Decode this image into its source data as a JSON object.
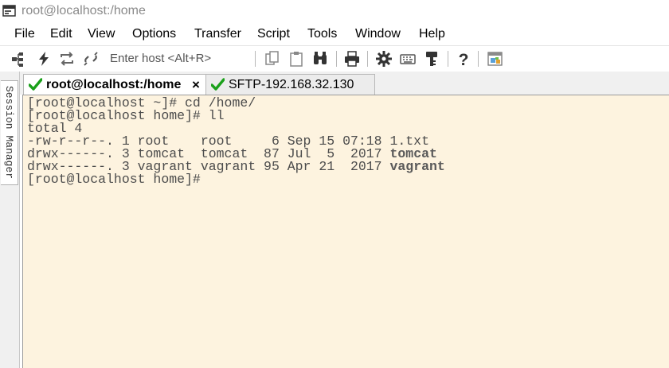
{
  "window": {
    "title": "root@localhost:/home"
  },
  "menu": [
    "File",
    "Edit",
    "View",
    "Options",
    "Transfer",
    "Script",
    "Tools",
    "Window",
    "Help"
  ],
  "toolbar": {
    "host_placeholder": "Enter host <Alt+R>",
    "icons": [
      "connect-icon",
      "quick-connect-icon",
      "reconnect-icon",
      "disconnect-icon",
      "copy-icon",
      "paste-icon",
      "find-icon",
      "print-icon",
      "settings-icon",
      "keymap-icon",
      "key-agent-icon",
      "help-icon",
      "sftp-icon"
    ]
  },
  "session_manager": {
    "label": "Session Manager"
  },
  "tabs": [
    {
      "label": "root@localhost:/home",
      "active": true,
      "close": "×"
    },
    {
      "label": "SFTP-192.168.32.130",
      "active": false
    }
  ],
  "terminal": {
    "lines": [
      {
        "segments": [
          {
            "text": "[root@localhost ~]# cd /home/"
          }
        ]
      },
      {
        "segments": [
          {
            "text": "[root@localhost home]# ll"
          }
        ]
      },
      {
        "segments": [
          {
            "text": "total 4"
          }
        ]
      },
      {
        "segments": [
          {
            "text": "-rw-r--r--. 1 root    root     6 Sep 15 07:18 1.txt"
          }
        ]
      },
      {
        "segments": [
          {
            "text": "drwx------. 3 tomcat  tomcat  87 Jul  5  2017 "
          },
          {
            "text": "tomcat",
            "style": "dir"
          }
        ]
      },
      {
        "segments": [
          {
            "text": "drwx------. 3 vagrant vagrant 95 Apr 21  2017 "
          },
          {
            "text": "vagrant",
            "style": "dir"
          }
        ]
      },
      {
        "segments": [
          {
            "text": "[root@localhost home]#"
          }
        ]
      }
    ]
  },
  "colors": {
    "terminal_bg": "#fdf3df",
    "terminal_text": "#4c4c4c",
    "check_green": "#1aa01a"
  }
}
